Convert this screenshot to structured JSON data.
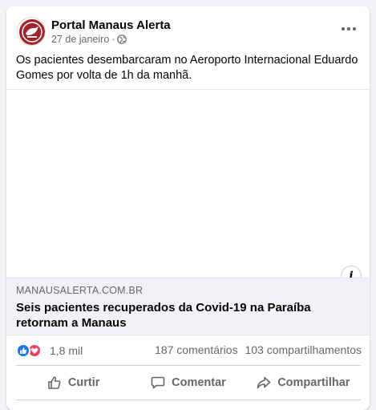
{
  "post": {
    "page_name": "Portal Manaus Alerta",
    "date": "27 de janeiro",
    "separator": "·",
    "privacy_icon": "globe-icon",
    "text": "Os pacientes desembarcaram no Aeroporto Internacional Eduardo Gomes por volta de 1h da manhã."
  },
  "link": {
    "domain": "MANAUSALERTA.COM.BR",
    "title": "Seis pacientes recuperados da Covid-19 na Paraíba retornam a Manaus",
    "info_icon": "i"
  },
  "engagement": {
    "reactions_count": "1,8 mil",
    "comments": "187 comentários",
    "shares": "103 compartilhamentos"
  },
  "actions": {
    "like": "Curtir",
    "comment": "Comentar",
    "share": "Compartilhar"
  },
  "colors": {
    "brand_blue": "#1877f2",
    "love_red": "#f33e58",
    "avatar_red": "#a3232b",
    "secondary_text": "#65676b"
  }
}
